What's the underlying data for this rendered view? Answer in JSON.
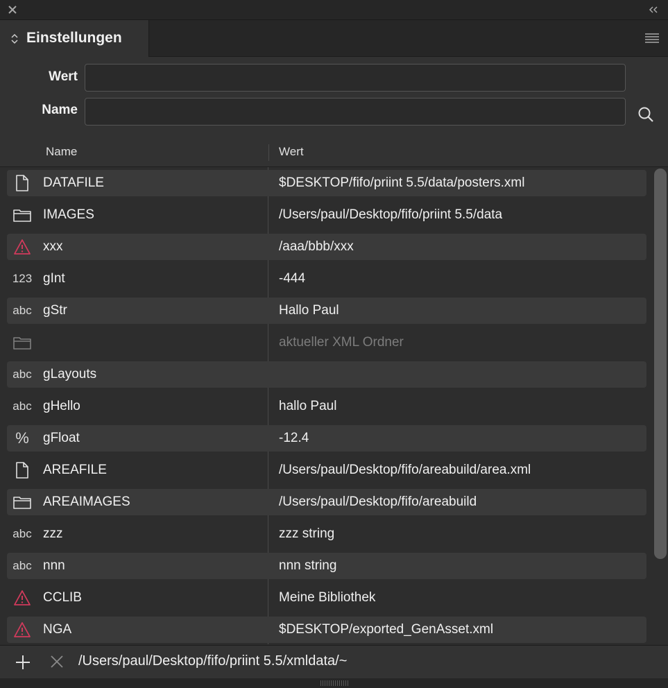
{
  "panel": {
    "tab_label": "Einstellungen"
  },
  "search": {
    "wert_label": "Wert",
    "wert_value": "",
    "name_label": "Name",
    "name_value": ""
  },
  "table": {
    "columns": [
      "Name",
      "Wert"
    ],
    "rows": [
      {
        "icon": "file-icon",
        "icon_text": "",
        "name": "DATAFILE",
        "value": "$DESKTOP/fifo/priint 5.5/data/posters.xml",
        "dim": false
      },
      {
        "icon": "folder-icon",
        "icon_text": "",
        "name": "IMAGES",
        "value": "/Users/paul/Desktop/fifo/priint 5.5/data",
        "dim": false
      },
      {
        "icon": "warning-icon",
        "icon_text": "",
        "name": "xxx",
        "value": "/aaa/bbb/xxx",
        "dim": false
      },
      {
        "icon": "int-type-icon",
        "icon_text": "123",
        "name": "gInt",
        "value": "-444",
        "dim": false
      },
      {
        "icon": "string-type-icon",
        "icon_text": "abc",
        "name": "gStr",
        "value": "Hallo Paul",
        "dim": false
      },
      {
        "icon": "folder-icon",
        "icon_text": "",
        "name": "",
        "value": "aktueller XML Ordner",
        "dim": true
      },
      {
        "icon": "string-type-icon",
        "icon_text": "abc",
        "name": "gLayouts",
        "value": "",
        "dim": false
      },
      {
        "icon": "string-type-icon",
        "icon_text": "abc",
        "name": "gHello",
        "value": "hallo Paul",
        "dim": false
      },
      {
        "icon": "float-type-icon",
        "icon_text": "%",
        "name": "gFloat",
        "value": "-12.4",
        "dim": false
      },
      {
        "icon": "file-icon",
        "icon_text": "",
        "name": "AREAFILE",
        "value": "/Users/paul/Desktop/fifo/areabuild/area.xml",
        "dim": false
      },
      {
        "icon": "folder-icon",
        "icon_text": "",
        "name": "AREAIMAGES",
        "value": "/Users/paul/Desktop/fifo/areabuild",
        "dim": false
      },
      {
        "icon": "string-type-icon",
        "icon_text": "abc",
        "name": "zzz",
        "value": "zzz string",
        "dim": false
      },
      {
        "icon": "string-type-icon",
        "icon_text": "abc",
        "name": "nnn",
        "value": "nnn string",
        "dim": false
      },
      {
        "icon": "warning-icon",
        "icon_text": "",
        "name": "CCLIB",
        "value": "Meine Bibliothek",
        "dim": false
      },
      {
        "icon": "warning-icon",
        "icon_text": "",
        "name": "NGA",
        "value": "$DESKTOP/exported_GenAsset.xml",
        "dim": false
      }
    ]
  },
  "footer": {
    "path": "/Users/paul/Desktop/fifo/priint 5.5/xmldata/~"
  },
  "colors": {
    "warning": "#d13a5c",
    "background": "#2b2b2b",
    "row_alt": "#3a3a3a"
  }
}
